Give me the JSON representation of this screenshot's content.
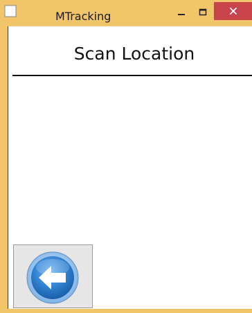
{
  "window": {
    "title": "MTracking"
  },
  "controls": {
    "minimize": "minimize-icon",
    "maximize": "maximize-icon",
    "close": "close-icon"
  },
  "page": {
    "title": "Scan Location"
  },
  "back_button": {
    "icon": "back-arrow-icon"
  },
  "colors": {
    "frame": "#f3c56b",
    "close_button": "#c9434a",
    "back_icon": "#2f7fd0"
  }
}
